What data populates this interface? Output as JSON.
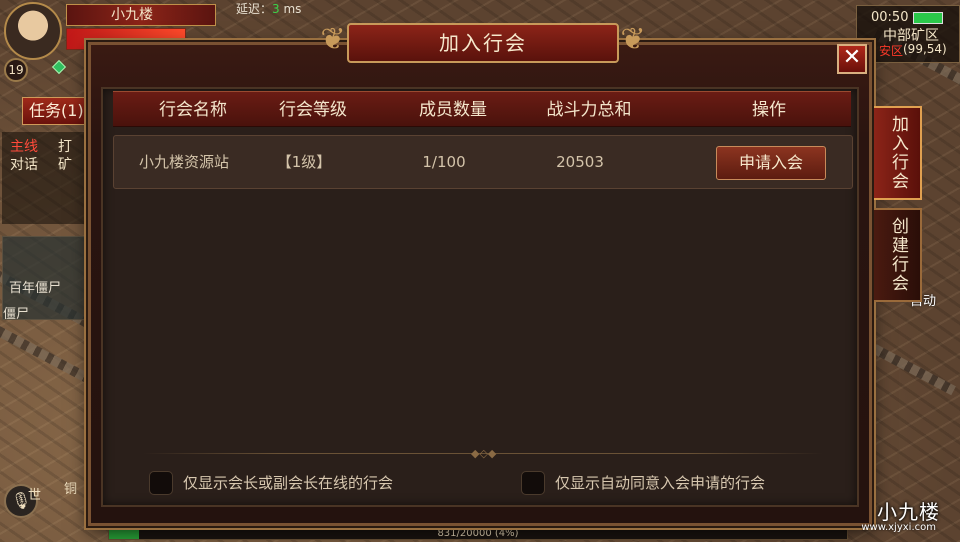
{
  "hud": {
    "player_name": "小九楼",
    "level": "19",
    "latency_label": "延迟：",
    "latency_value": "3",
    "latency_unit": "ms",
    "task_button": "任务(1)",
    "tasks": {
      "main_tag": "主线",
      "main_text": "打",
      "talk_tag": "对话",
      "talk_text": "矿"
    },
    "monster_name": "百年僵尸",
    "monster_name2": "僵尸",
    "chat_world": "世",
    "chat_other": "铜",
    "time": "00:50",
    "area_name": "中部矿区",
    "area_tag": "安区",
    "area_coord": "(99,54)",
    "exp_text": "831/20000 (4%)",
    "exp_fraction": 0.04,
    "skill_label": "自动"
  },
  "dialog": {
    "title": "加入行会",
    "close_symbol": "✕",
    "columns": [
      "行会名称",
      "行会等级",
      "成员数量",
      "战斗力总和",
      "操作"
    ],
    "guilds": [
      {
        "name": "小九楼资源站",
        "level": "【1级】",
        "members": "1/100",
        "power": "20503",
        "action": "申请入会"
      }
    ],
    "filters": {
      "online_leader": "仅显示会长或副会长在线的行会",
      "auto_accept": "仅显示自动同意入会申请的行会"
    }
  },
  "side_tabs": [
    {
      "label": "加入行会",
      "active": true
    },
    {
      "label": "创建行会",
      "active": false
    }
  ],
  "watermark": {
    "title": "小九楼",
    "url": "www.xjyxi.com"
  }
}
